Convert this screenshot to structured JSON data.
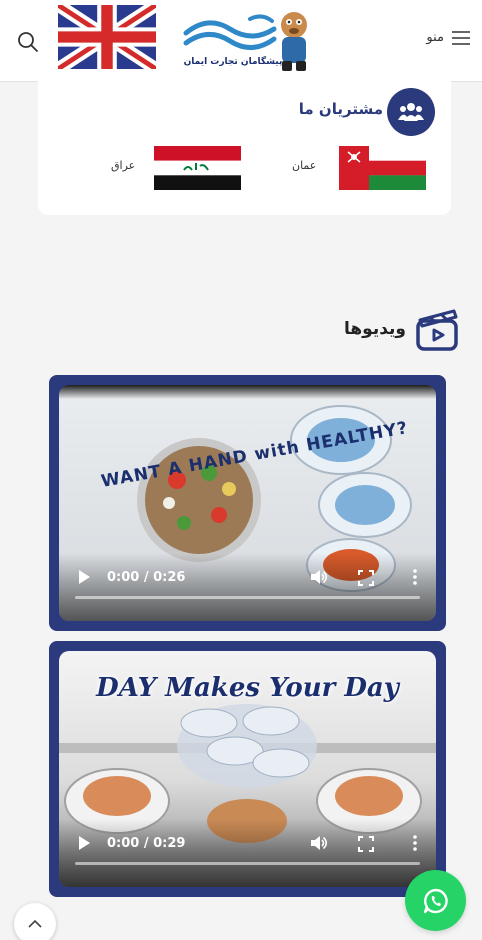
{
  "header": {
    "menu_label": "منو",
    "logo_text": "پیشگامان تجارت ایمان"
  },
  "customers": {
    "title": "مشتریان ما",
    "items": [
      {
        "label": "عمان"
      },
      {
        "label": "عراق"
      }
    ]
  },
  "videos": {
    "title": "ویدیوها",
    "items": [
      {
        "time": "0:00 / 0:26",
        "headline": "WANT A HAND with HEALTHY?"
      },
      {
        "time": "0:00 / 0:29",
        "headline": "DAY Makes Your Day"
      }
    ]
  },
  "colors": {
    "brand": "#2a3a7c",
    "whatsapp": "#25d366"
  }
}
